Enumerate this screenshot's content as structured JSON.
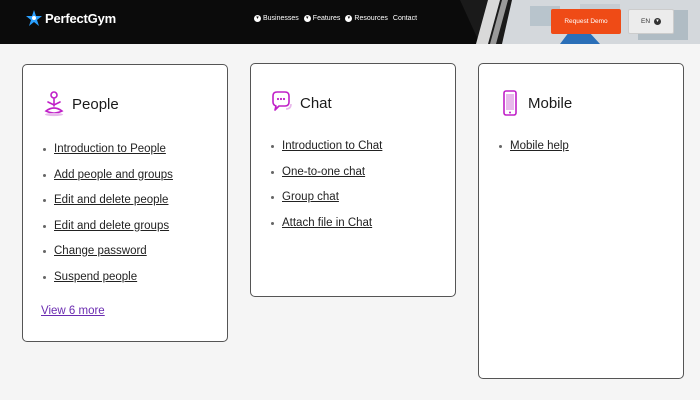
{
  "header": {
    "logo_text": "PerfectGym",
    "nav": [
      "Businesses",
      "Features",
      "Resources",
      "Contact"
    ],
    "demo_button": "Request Demo",
    "language": "EN"
  },
  "colors": {
    "accent": "#ef4b16",
    "icon_magenta": "#c020c8",
    "link_purple": "#6a2bb0",
    "logo_blue": "#2aa0ff"
  },
  "cards": {
    "people": {
      "title": "People",
      "icon": "person-meditation-icon",
      "links": [
        "Introduction to People",
        "Add people and groups",
        "Edit and delete people",
        "Edit and delete groups",
        "Change password",
        "Suspend people"
      ],
      "more": "View 6 more"
    },
    "chat": {
      "title": "Chat",
      "icon": "chat-bubble-icon",
      "links": [
        "Introduction to Chat",
        "One-to-one chat",
        "Group chat",
        "Attach file in Chat"
      ]
    },
    "mobile": {
      "title": "Mobile",
      "icon": "mobile-phone-icon",
      "links": [
        "Mobile help"
      ]
    }
  }
}
